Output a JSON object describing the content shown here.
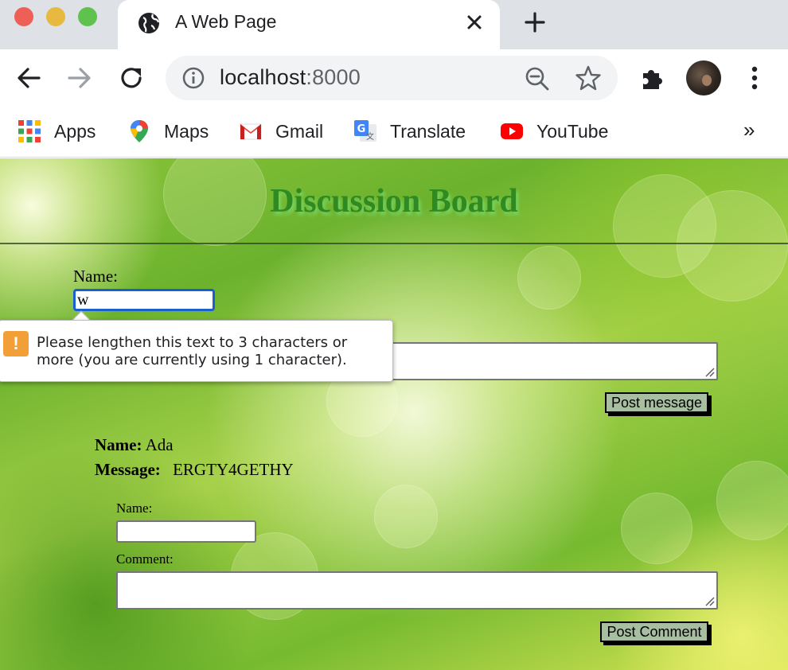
{
  "browser": {
    "tab_title": "A Web Page",
    "url_host": "localhost",
    "url_port": ":8000",
    "bookmarks": [
      {
        "label": "Apps",
        "icon": "apps-grid-icon"
      },
      {
        "label": "Maps",
        "icon": "maps-icon"
      },
      {
        "label": "Gmail",
        "icon": "gmail-icon"
      },
      {
        "label": "Translate",
        "icon": "translate-icon"
      },
      {
        "label": "YouTube",
        "icon": "youtube-icon"
      }
    ],
    "overflow": "»"
  },
  "page": {
    "title": "Discussion Board",
    "form": {
      "name_label": "Name:",
      "name_value": "w",
      "post_button": "Post message"
    },
    "validation": {
      "message": "Please lengthen this text to 3 characters or more (you are currently using 1 character).",
      "icon": "!"
    },
    "post": {
      "name_label": "Name:",
      "name_value": "Ada",
      "message_label": "Message:",
      "message_value": "ERGTY4GETHY"
    },
    "comment_form": {
      "name_label": "Name:",
      "comment_label": "Comment:",
      "post_button": "Post Comment"
    }
  },
  "colors": {
    "title_green": "#2f8a22",
    "button_bg": "#a7bfa0",
    "focus_blue": "#1a5fd0",
    "warning_orange": "#f29f37"
  }
}
